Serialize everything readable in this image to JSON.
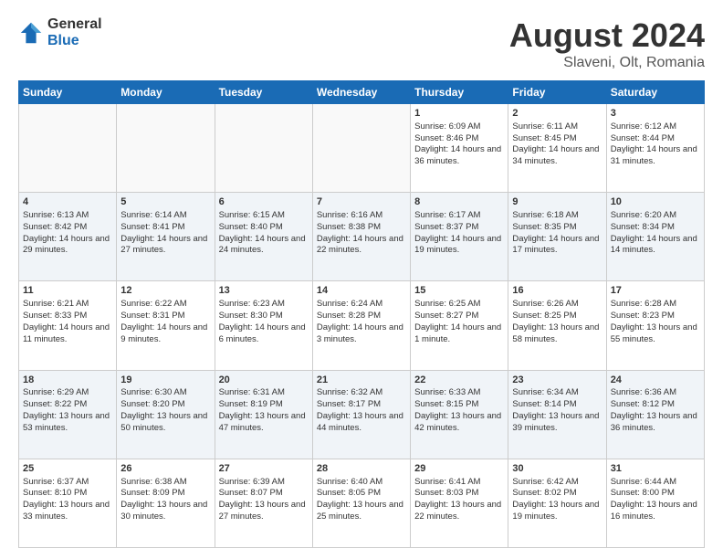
{
  "header": {
    "logo_general": "General",
    "logo_blue": "Blue",
    "title": "August 2024",
    "location": "Slaveni, Olt, Romania"
  },
  "days_of_week": [
    "Sunday",
    "Monday",
    "Tuesday",
    "Wednesday",
    "Thursday",
    "Friday",
    "Saturday"
  ],
  "weeks": [
    {
      "shaded": false,
      "days": [
        {
          "num": "",
          "info": "",
          "empty": true
        },
        {
          "num": "",
          "info": "",
          "empty": true
        },
        {
          "num": "",
          "info": "",
          "empty": true
        },
        {
          "num": "",
          "info": "",
          "empty": true
        },
        {
          "num": "1",
          "info": "Sunrise: 6:09 AM\nSunset: 8:46 PM\nDaylight: 14 hours and 36 minutes.",
          "empty": false
        },
        {
          "num": "2",
          "info": "Sunrise: 6:11 AM\nSunset: 8:45 PM\nDaylight: 14 hours and 34 minutes.",
          "empty": false
        },
        {
          "num": "3",
          "info": "Sunrise: 6:12 AM\nSunset: 8:44 PM\nDaylight: 14 hours and 31 minutes.",
          "empty": false
        }
      ]
    },
    {
      "shaded": true,
      "days": [
        {
          "num": "4",
          "info": "Sunrise: 6:13 AM\nSunset: 8:42 PM\nDaylight: 14 hours and 29 minutes.",
          "empty": false
        },
        {
          "num": "5",
          "info": "Sunrise: 6:14 AM\nSunset: 8:41 PM\nDaylight: 14 hours and 27 minutes.",
          "empty": false
        },
        {
          "num": "6",
          "info": "Sunrise: 6:15 AM\nSunset: 8:40 PM\nDaylight: 14 hours and 24 minutes.",
          "empty": false
        },
        {
          "num": "7",
          "info": "Sunrise: 6:16 AM\nSunset: 8:38 PM\nDaylight: 14 hours and 22 minutes.",
          "empty": false
        },
        {
          "num": "8",
          "info": "Sunrise: 6:17 AM\nSunset: 8:37 PM\nDaylight: 14 hours and 19 minutes.",
          "empty": false
        },
        {
          "num": "9",
          "info": "Sunrise: 6:18 AM\nSunset: 8:35 PM\nDaylight: 14 hours and 17 minutes.",
          "empty": false
        },
        {
          "num": "10",
          "info": "Sunrise: 6:20 AM\nSunset: 8:34 PM\nDaylight: 14 hours and 14 minutes.",
          "empty": false
        }
      ]
    },
    {
      "shaded": false,
      "days": [
        {
          "num": "11",
          "info": "Sunrise: 6:21 AM\nSunset: 8:33 PM\nDaylight: 14 hours and 11 minutes.",
          "empty": false
        },
        {
          "num": "12",
          "info": "Sunrise: 6:22 AM\nSunset: 8:31 PM\nDaylight: 14 hours and 9 minutes.",
          "empty": false
        },
        {
          "num": "13",
          "info": "Sunrise: 6:23 AM\nSunset: 8:30 PM\nDaylight: 14 hours and 6 minutes.",
          "empty": false
        },
        {
          "num": "14",
          "info": "Sunrise: 6:24 AM\nSunset: 8:28 PM\nDaylight: 14 hours and 3 minutes.",
          "empty": false
        },
        {
          "num": "15",
          "info": "Sunrise: 6:25 AM\nSunset: 8:27 PM\nDaylight: 14 hours and 1 minute.",
          "empty": false
        },
        {
          "num": "16",
          "info": "Sunrise: 6:26 AM\nSunset: 8:25 PM\nDaylight: 13 hours and 58 minutes.",
          "empty": false
        },
        {
          "num": "17",
          "info": "Sunrise: 6:28 AM\nSunset: 8:23 PM\nDaylight: 13 hours and 55 minutes.",
          "empty": false
        }
      ]
    },
    {
      "shaded": true,
      "days": [
        {
          "num": "18",
          "info": "Sunrise: 6:29 AM\nSunset: 8:22 PM\nDaylight: 13 hours and 53 minutes.",
          "empty": false
        },
        {
          "num": "19",
          "info": "Sunrise: 6:30 AM\nSunset: 8:20 PM\nDaylight: 13 hours and 50 minutes.",
          "empty": false
        },
        {
          "num": "20",
          "info": "Sunrise: 6:31 AM\nSunset: 8:19 PM\nDaylight: 13 hours and 47 minutes.",
          "empty": false
        },
        {
          "num": "21",
          "info": "Sunrise: 6:32 AM\nSunset: 8:17 PM\nDaylight: 13 hours and 44 minutes.",
          "empty": false
        },
        {
          "num": "22",
          "info": "Sunrise: 6:33 AM\nSunset: 8:15 PM\nDaylight: 13 hours and 42 minutes.",
          "empty": false
        },
        {
          "num": "23",
          "info": "Sunrise: 6:34 AM\nSunset: 8:14 PM\nDaylight: 13 hours and 39 minutes.",
          "empty": false
        },
        {
          "num": "24",
          "info": "Sunrise: 6:36 AM\nSunset: 8:12 PM\nDaylight: 13 hours and 36 minutes.",
          "empty": false
        }
      ]
    },
    {
      "shaded": false,
      "days": [
        {
          "num": "25",
          "info": "Sunrise: 6:37 AM\nSunset: 8:10 PM\nDaylight: 13 hours and 33 minutes.",
          "empty": false
        },
        {
          "num": "26",
          "info": "Sunrise: 6:38 AM\nSunset: 8:09 PM\nDaylight: 13 hours and 30 minutes.",
          "empty": false
        },
        {
          "num": "27",
          "info": "Sunrise: 6:39 AM\nSunset: 8:07 PM\nDaylight: 13 hours and 27 minutes.",
          "empty": false
        },
        {
          "num": "28",
          "info": "Sunrise: 6:40 AM\nSunset: 8:05 PM\nDaylight: 13 hours and 25 minutes.",
          "empty": false
        },
        {
          "num": "29",
          "info": "Sunrise: 6:41 AM\nSunset: 8:03 PM\nDaylight: 13 hours and 22 minutes.",
          "empty": false
        },
        {
          "num": "30",
          "info": "Sunrise: 6:42 AM\nSunset: 8:02 PM\nDaylight: 13 hours and 19 minutes.",
          "empty": false
        },
        {
          "num": "31",
          "info": "Sunrise: 6:44 AM\nSunset: 8:00 PM\nDaylight: 13 hours and 16 minutes.",
          "empty": false
        }
      ]
    }
  ]
}
